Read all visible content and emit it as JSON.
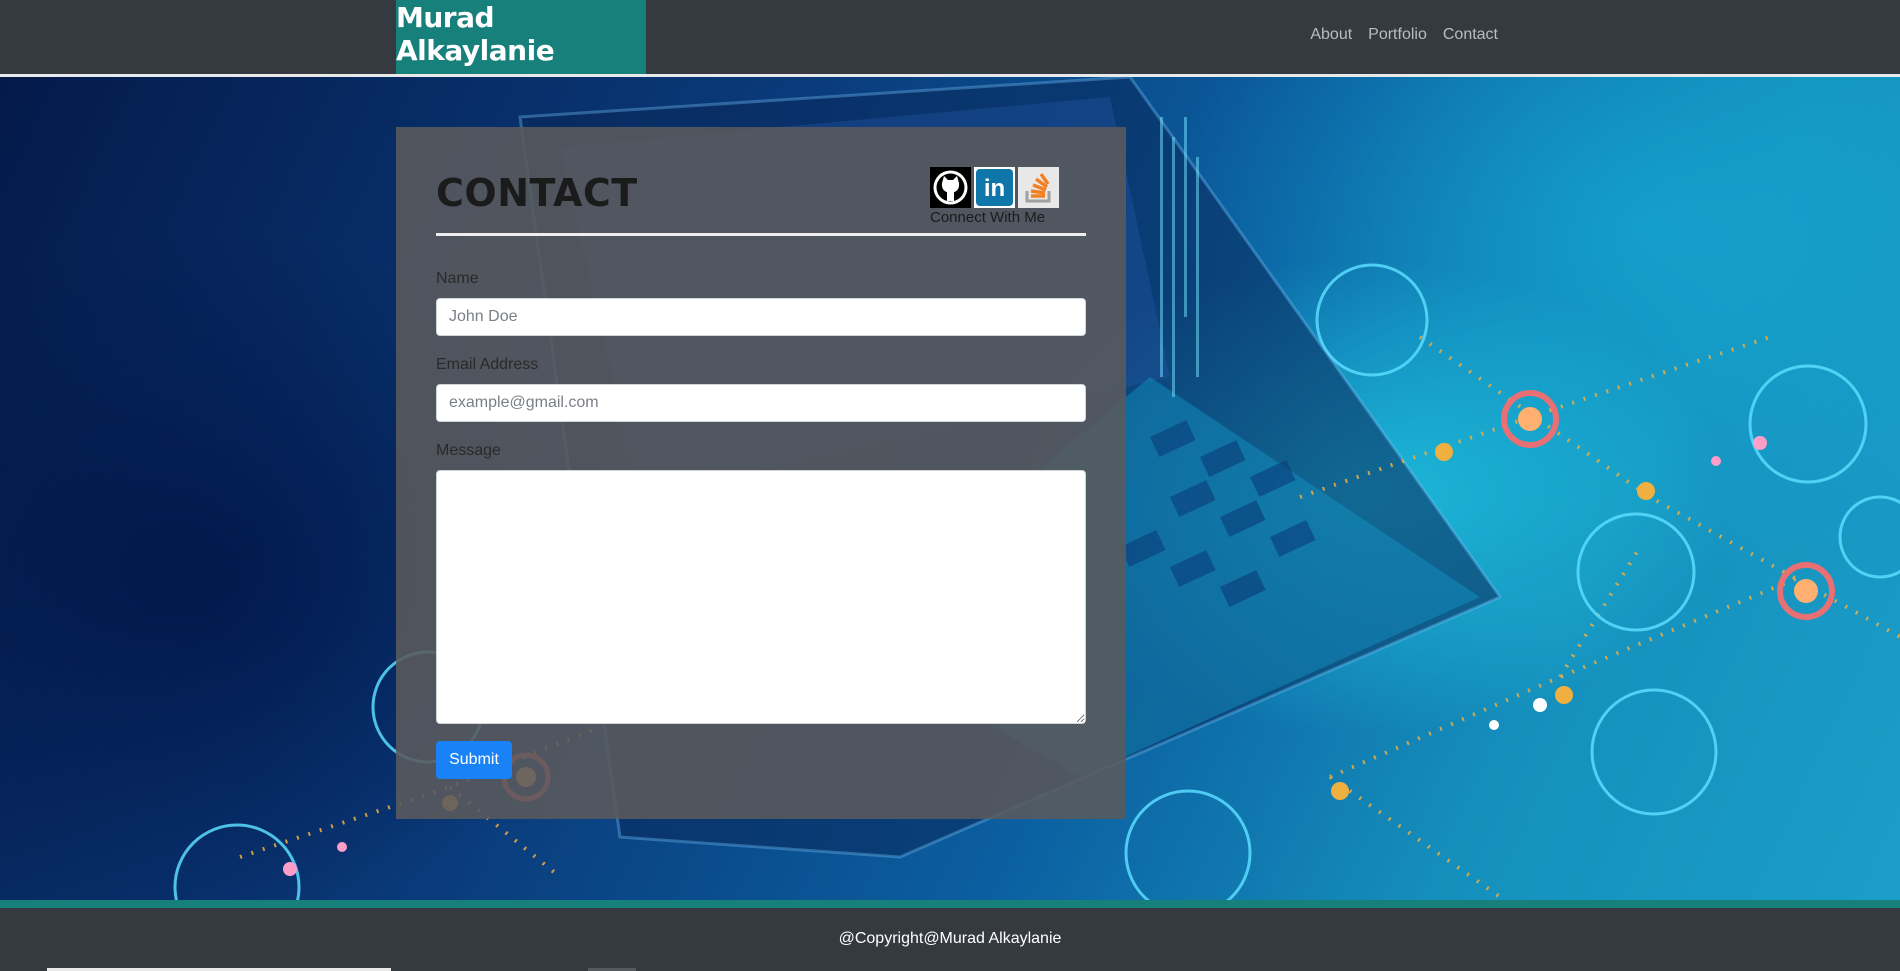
{
  "navbar": {
    "brand": "Murad Alkaylanie",
    "links": [
      {
        "label": "About"
      },
      {
        "label": "Portfolio"
      },
      {
        "label": "Contact"
      }
    ]
  },
  "contact": {
    "title": "CONTACT",
    "social": {
      "label": "Connect With Me",
      "icons": [
        "github-icon",
        "linkedin-icon",
        "stackoverflow-icon"
      ]
    },
    "form": {
      "name_label": "Name",
      "name_placeholder": "John Doe",
      "email_label": "Email Address",
      "email_placeholder": "example@gmail.com",
      "message_label": "Message",
      "message_value": "",
      "submit_label": "Submit"
    }
  },
  "footer": {
    "copyright": "@Copyright@Murad Alkaylanie"
  },
  "colors": {
    "nav_bg": "#343a40",
    "brand_bg": "#17807a",
    "panel_bg": "#5a5a5c",
    "submit_bg": "#1a82f7",
    "footer_accent": "#17807a"
  }
}
